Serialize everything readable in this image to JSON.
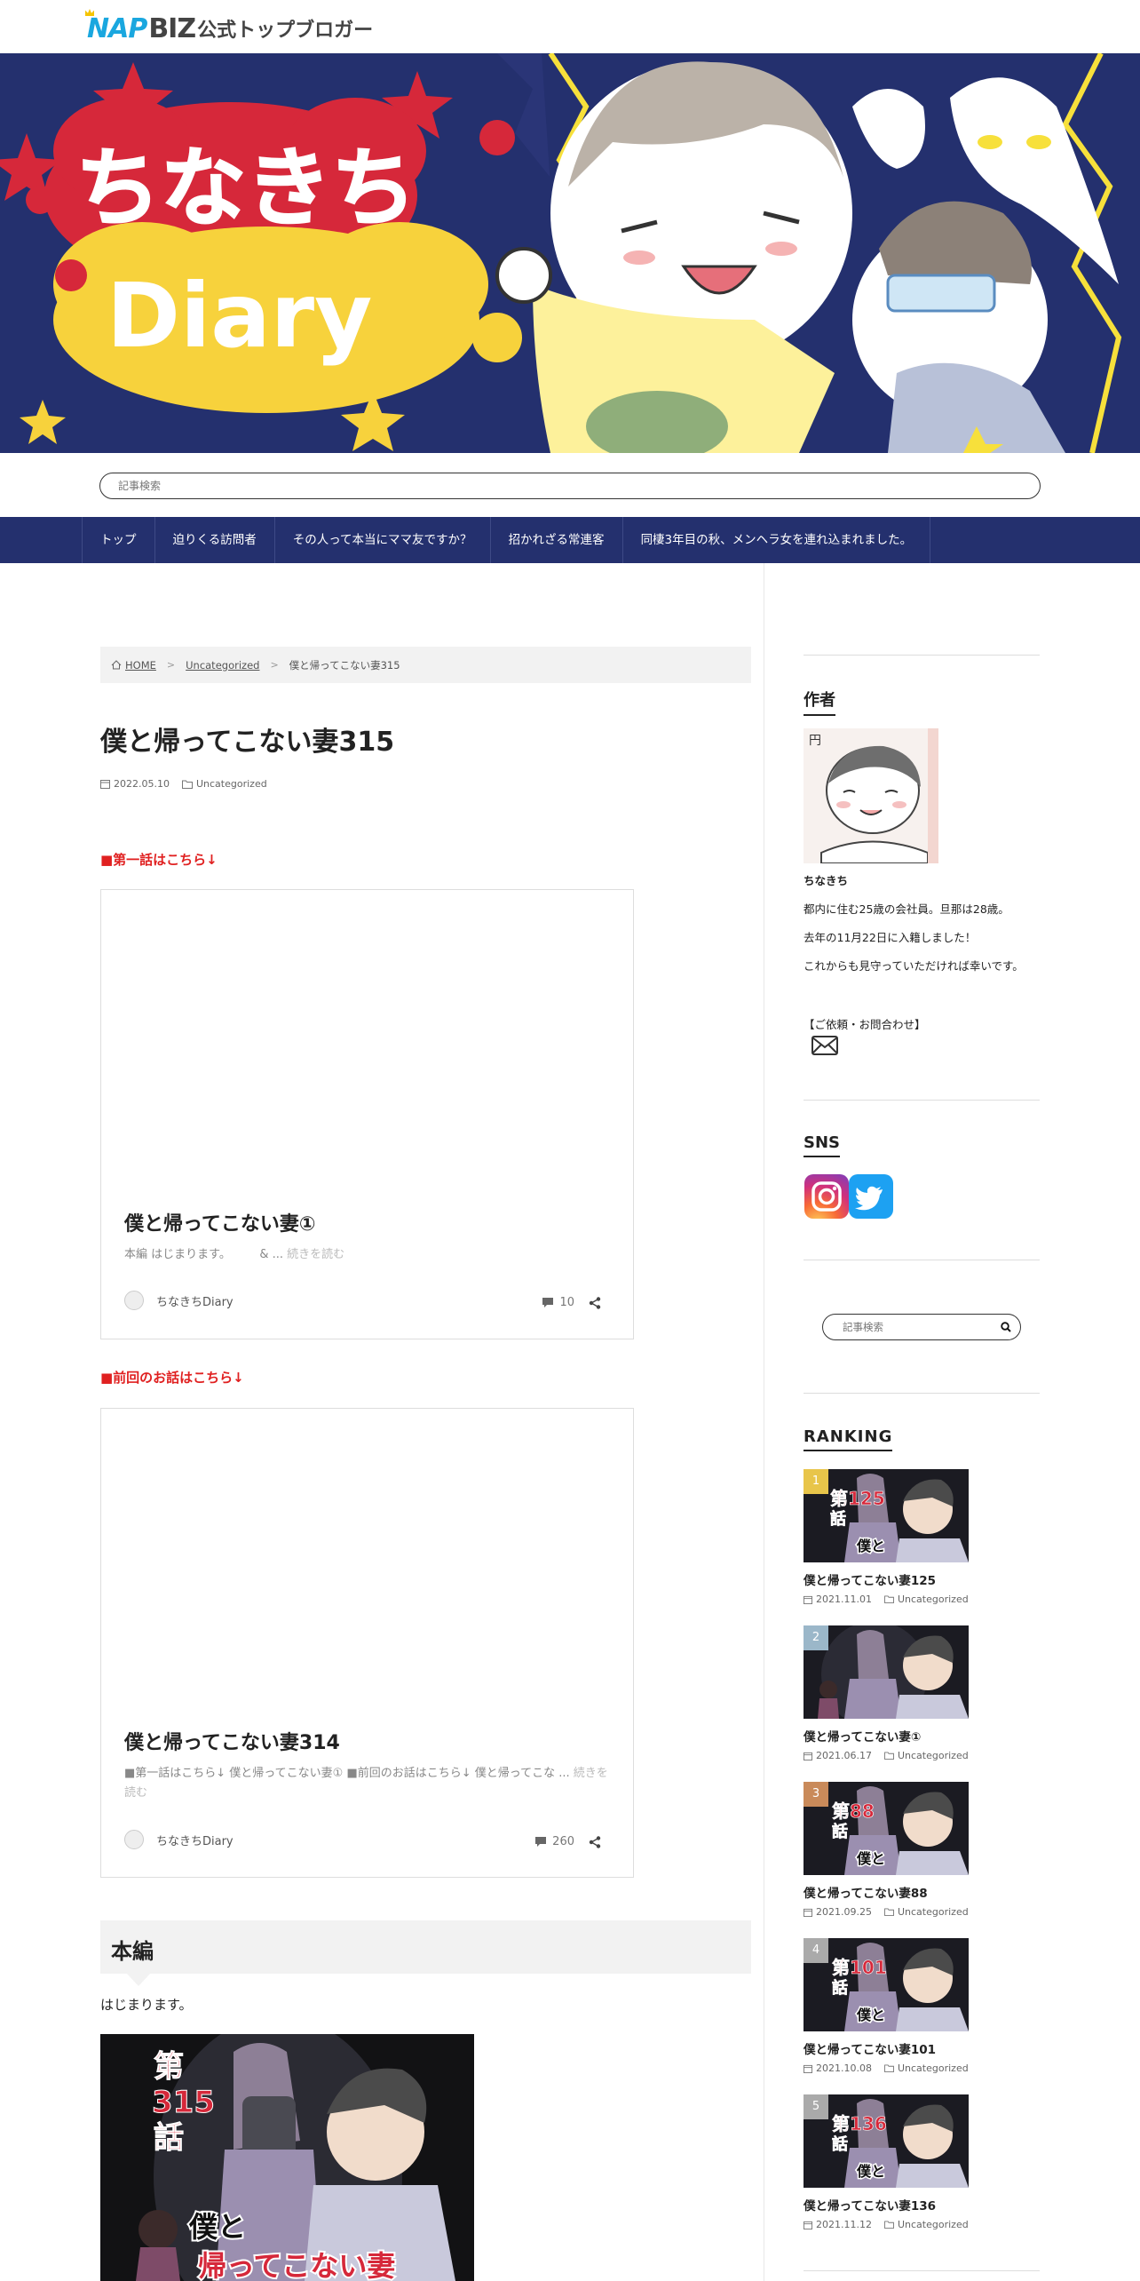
{
  "header": {
    "logo_nap": "NAP",
    "logo_biz": "BIZ",
    "logo_jp": "公式トップブロガー",
    "hero_title_1": "ちなきち",
    "hero_title_2": "Diary"
  },
  "search": {
    "placeholder": "記事検索"
  },
  "nav": {
    "items": [
      "トップ",
      "迫りくる訪問者",
      "その人って本当にママ友ですか？",
      "招かれざる常連客",
      "同棲3年目の秋、メンヘラ女を連れ込まれました。"
    ]
  },
  "breadcrumb": {
    "home": "HOME",
    "category": "Uncategorized",
    "current": "僕と帰ってこない妻315"
  },
  "post": {
    "title": "僕と帰ってこない妻315",
    "date": "2022.05.10",
    "category": "Uncategorized",
    "first_label": "■第一話はこちら↓",
    "prev_label": "■前回のお話はこちら↓",
    "section_heading": "本編",
    "intro": "はじまります。",
    "comic_episode": "第315話",
    "comic_title_1": "僕と",
    "comic_title_2": "帰ってこない妻"
  },
  "cards": [
    {
      "title": "僕と帰ってこない妻①",
      "excerpt": "本編 はじまります。　　　& ...",
      "more": "続きを読む",
      "author": "ちなきちDiary",
      "comments": "10"
    },
    {
      "title": "僕と帰ってこない妻314",
      "excerpt": "■第一話はこちら↓ 僕と帰ってこない妻① ■前回のお話はこちら↓ 僕と帰ってこな ...",
      "more": "続きを読む",
      "author": "ちなきちDiary",
      "comments": "260"
    }
  ],
  "sidebar": {
    "author_heading": "作者",
    "author_name": "ちなきち",
    "bio_1": "都内に住む25歳の会社員。旦那は28歳。",
    "bio_2": "去年の11月22日に入籍しました！",
    "bio_3": "これからも見守っていただければ幸いです。",
    "contact": "【ご依頼・お問合わせ】",
    "sns_heading": "SNS",
    "search_placeholder": "記事検索",
    "ranking_heading": "RANKING",
    "ranking": [
      {
        "rank": "1",
        "title": "僕と帰ってこない妻125",
        "date": "2021.11.01",
        "category": "Uncategorized",
        "badge": "#e8c54a",
        "ep": "第125話"
      },
      {
        "rank": "2",
        "title": "僕と帰ってこない妻①",
        "date": "2021.06.17",
        "category": "Uncategorized",
        "badge": "#9bb7c9",
        "ep": ""
      },
      {
        "rank": "3",
        "title": "僕と帰ってこない妻88",
        "date": "2021.09.25",
        "category": "Uncategorized",
        "badge": "#c98a5a",
        "ep": "第88話"
      },
      {
        "rank": "4",
        "title": "僕と帰ってこない妻101",
        "date": "2021.10.08",
        "category": "Uncategorized",
        "badge": "#aaaaaa",
        "ep": "第101話"
      },
      {
        "rank": "5",
        "title": "僕と帰ってこない妻136",
        "date": "2021.11.12",
        "category": "Uncategorized",
        "badge": "#aaaaaa",
        "ep": "第136話"
      }
    ]
  }
}
